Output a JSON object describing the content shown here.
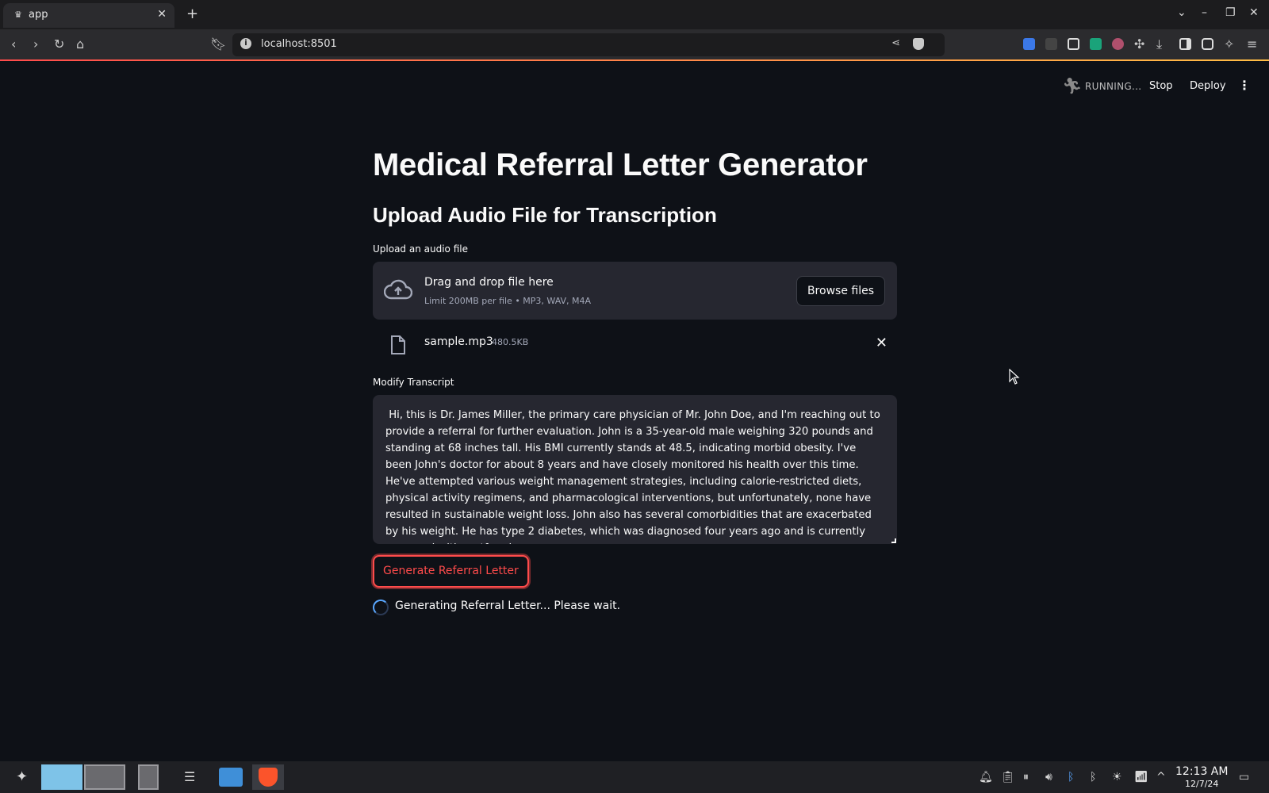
{
  "browser": {
    "tab_title": "app",
    "url": "localhost:8501"
  },
  "header": {
    "status": "RUNNING...",
    "stop_label": "Stop",
    "deploy_label": "Deploy"
  },
  "main": {
    "title": "Medical Referral Letter Generator",
    "section_title": "Upload Audio File for Transcription",
    "uploader": {
      "label": "Upload an audio file",
      "drop_text": "Drag and drop file here",
      "limit_text": "Limit 200MB per file • MP3, WAV, M4A",
      "browse_label": "Browse files"
    },
    "uploaded_file": {
      "name": "sample.mp3",
      "size": "480.5KB"
    },
    "transcript": {
      "label": "Modify Transcript",
      "value": " Hi, this is Dr. James Miller, the primary care physician of Mr. John Doe, and I'm reaching out to provide a referral for further evaluation. John is a 35-year-old male weighing 320 pounds and standing at 68 inches tall. His BMI currently stands at 48.5, indicating morbid obesity. I've been John's doctor for about 8 years and have closely monitored his health over this time. He've attempted various weight management strategies, including calorie-restricted diets, physical activity regimens, and pharmacological interventions, but unfortunately, none have resulted in sustainable weight loss. John also has several comorbidities that are exacerbated by his weight. He has type 2 diabetes, which was diagnosed four years ago and is currently managed with metformin."
    },
    "generate_label": "Generate Referral Letter",
    "status_message": "Generating Referral Letter... Please wait."
  },
  "taskbar": {
    "time": "12:13 AM",
    "date": "12/7/24"
  },
  "colors": {
    "background": "#0e1117",
    "widget": "#262730",
    "accent": "#ff4b4b",
    "spinner": "#5aa7ff"
  }
}
